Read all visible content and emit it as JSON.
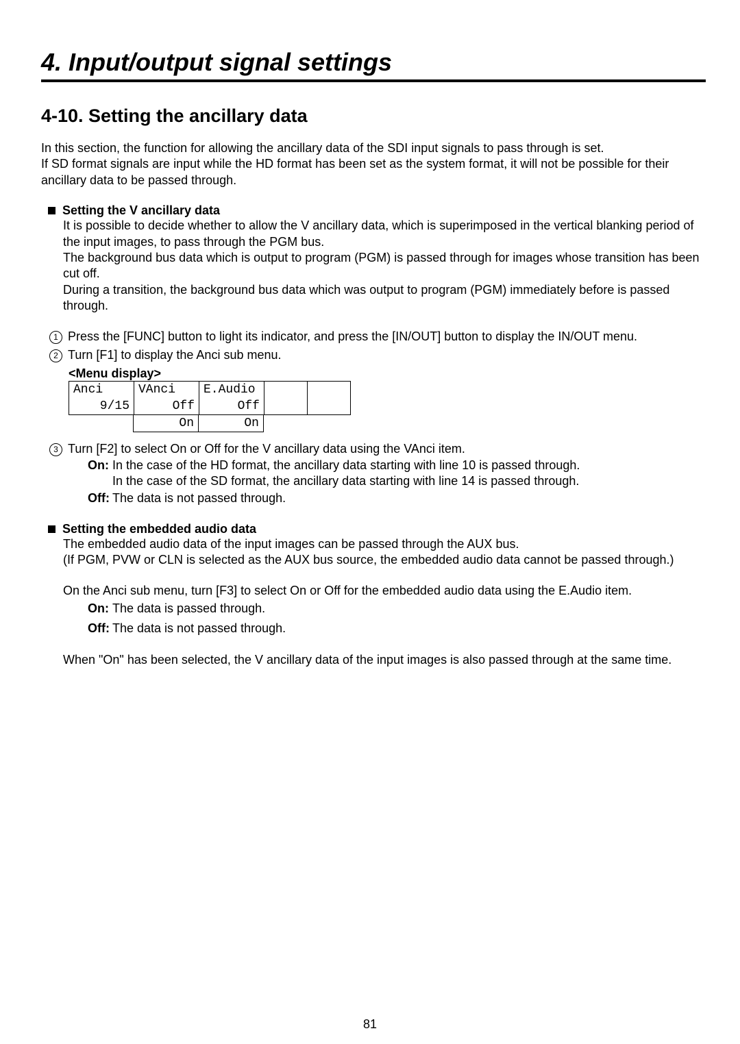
{
  "chapterTitle": "4. Input/output signal settings",
  "sectionTitle": "4-10. Setting the ancillary data",
  "intro": "In this section, the function for allowing the ancillary data of the SDI input signals to pass through is set.\nIf SD format signals are input while the HD format has been set as the system format, it will not be possible for their ancillary data to be passed through.",
  "sub1": {
    "heading": "Setting the V ancillary data",
    "para": "It is possible to decide whether to allow the V ancillary data, which is superimposed in the vertical blanking period of the input images, to pass through the PGM bus.\nThe background bus data which is output to program (PGM) is passed through for images whose transition has been cut off.\nDuring a transition, the background bus data which was output to program (PGM) immediately before is passed through.",
    "step1": "Press the [FUNC] button to light its indicator, and press the [IN/OUT] button to display the IN/OUT menu.",
    "step2": "Turn [F1] to display the Anci sub menu.",
    "menuDisplayLabel": "<Menu display>",
    "menu": {
      "col1_top": "Anci",
      "col1_bottom": " 9/15",
      "col2_top": "VAnci",
      "col2_bottom": "  Off",
      "col3_top": "E.Audio",
      "col3_bottom": "    Off",
      "col2_extra": "   On",
      "col3_extra": "     On"
    },
    "step3": "Turn [F2] to select On or Off for the V ancillary data using the VAnci item.",
    "onText1": "In the case of the HD format, the ancillary data starting with line 10 is passed through.",
    "onText2": "In the case of the SD format, the ancillary data starting with line 14 is passed through.",
    "offText": "The data is not passed through."
  },
  "sub2": {
    "heading": "Setting the embedded audio data",
    "para": "The embedded audio data of the input images can be passed through the AUX bus.\n(If PGM, PVW or CLN is selected as the AUX bus source, the embedded audio data cannot be passed through.)",
    "step": "On the Anci sub menu, turn [F3] to select On or Off for the embedded audio data using the E.Audio item.",
    "onText": "The data is passed through.",
    "offText": "The data is not passed through.",
    "note": "When \"On\" has been selected, the V ancillary data of the input images is also passed through at the same time."
  },
  "labels": {
    "on": "On:",
    "off": "Off:"
  },
  "pageNumber": "81"
}
